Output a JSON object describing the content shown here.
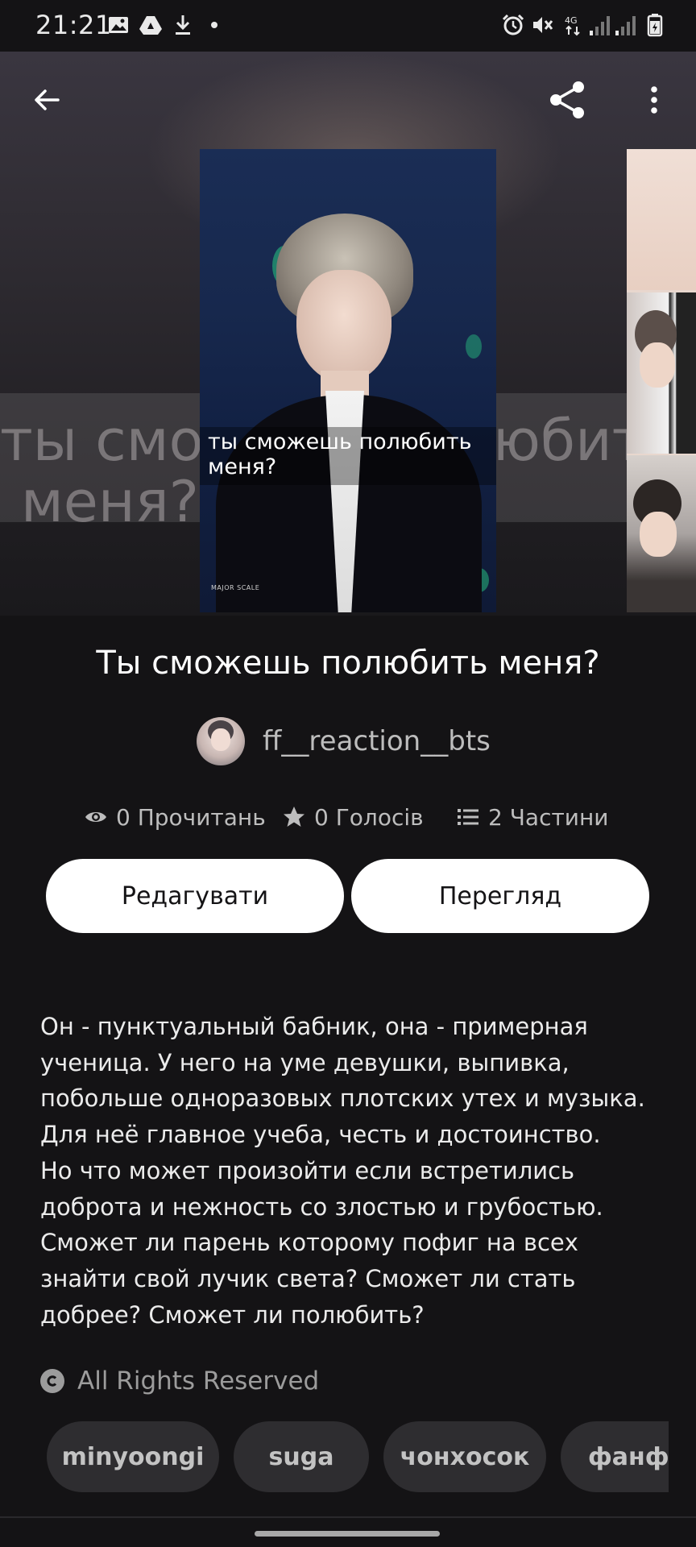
{
  "status_bar": {
    "time": "21:21",
    "icons": [
      "image-icon",
      "drive-icon",
      "download-icon",
      "dot-icon",
      "alarm-icon",
      "mute-icon",
      "4g-icon",
      "signal-icon",
      "signal-icon",
      "battery-icon"
    ]
  },
  "toolbar": {
    "back_icon": "arrow-left-icon",
    "share_icon": "share-icon",
    "more_icon": "more-vertical-icon"
  },
  "hero": {
    "bg_text_line1": "ты смо",
    "bg_text_line1_right": "юбит",
    "bg_text_line2": "меня?"
  },
  "cover": {
    "overlay_title": "ты сможешь полюбить меня?",
    "watermark": "MAJOR SCALE"
  },
  "story": {
    "title": "Ты сможешь полюбить меня?",
    "author": "ff__reaction__bts",
    "stats": {
      "reads": "0 Прочитань",
      "votes": "0 Голосів",
      "parts": "2 Частини"
    },
    "buttons": {
      "edit": "Редагувати",
      "preview": "Перегляд"
    },
    "description": "Он - пунктуальный бабник, она - примерная ученица. У него на уме девушки, выпивка, побольше одноразовых плотских утех и музыка. Для неё главное учеба, честь и достоинство.\nНо что может произойти если встретились доброта и нежность со злостью и грубостью. Сможет ли парень которому пофиг на всех знайти свой лучик света? Сможет ли стать добрее? Сможет ли полюбить?",
    "rights": "All Rights Reserved",
    "tags": [
      "minyoongi",
      "suga",
      "чонхосок",
      "фанфи"
    ]
  },
  "colors": {
    "background": "#141315",
    "button_bg": "#ffffff",
    "tag_bg": "#2e2d30",
    "muted_text": "#bdbdbd"
  }
}
